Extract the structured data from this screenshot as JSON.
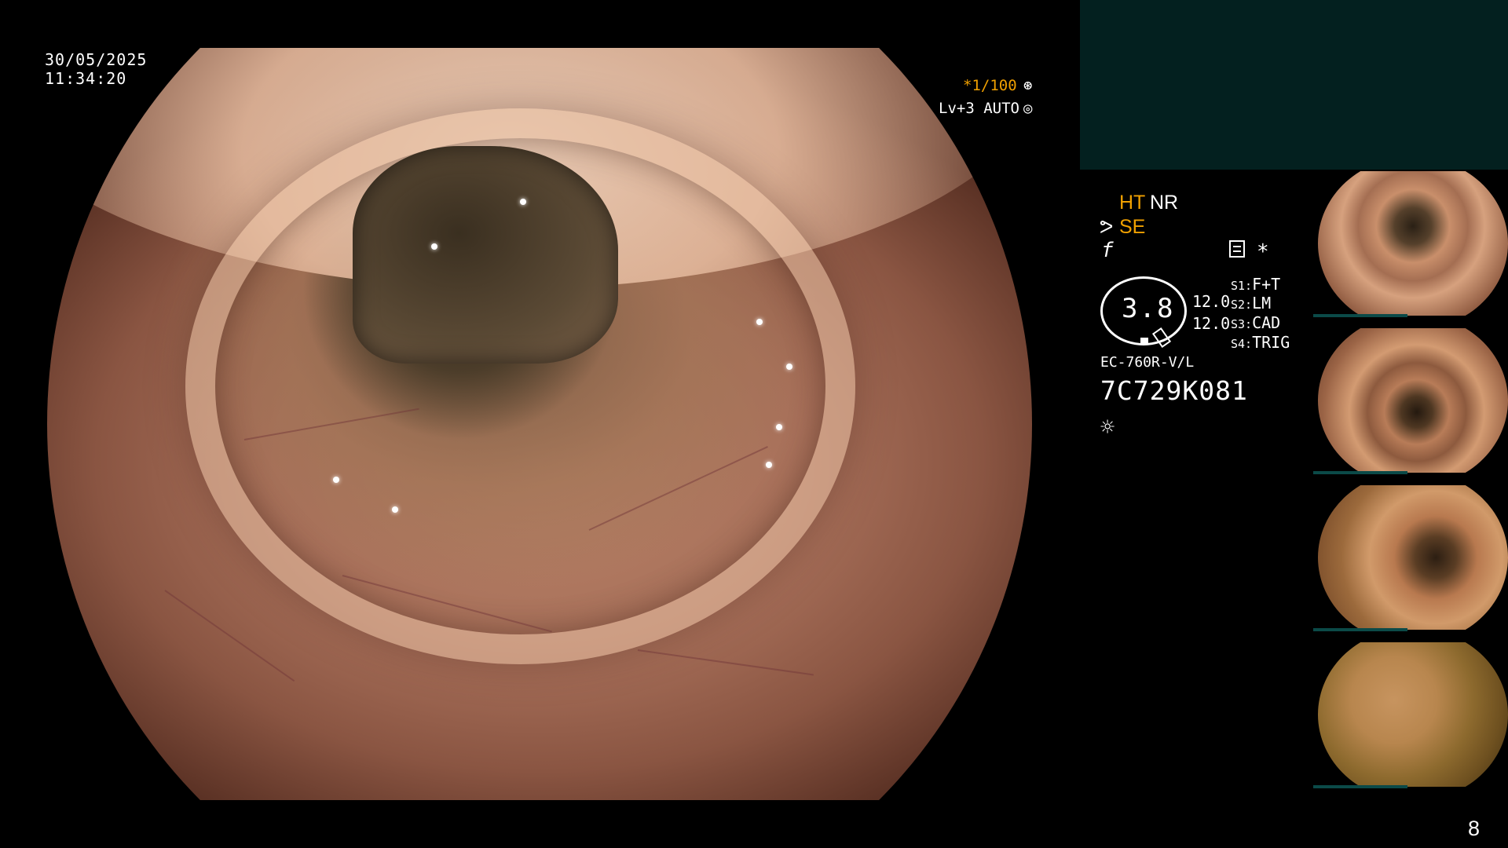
{
  "overlay": {
    "date": "30/05/2025",
    "time": "11:34:20",
    "shutter": "*1/100",
    "shutter_icon": "⊛",
    "level": "Lv+3 AUTO",
    "level_icon": "◎"
  },
  "settings": {
    "ht": "HT",
    "nr": "NR",
    "se_icon": "ᕗ",
    "se": "SE",
    "f_icon": "f",
    "asterisk": "*",
    "gauge_value": "3.8",
    "value_1": "12.0",
    "value_2": "12.0",
    "switches": [
      {
        "key": "S1:",
        "value": "F+T"
      },
      {
        "key": "S2:",
        "value": "LM"
      },
      {
        "key": "S3:",
        "value": "CAD"
      },
      {
        "key": "S4:",
        "value": "TRIG"
      }
    ],
    "model": "EC-760R-V/L",
    "serial": "7C729K081",
    "light_icon": "☼"
  },
  "page_number": "8",
  "icons": {
    "shutter": "shutter-icon",
    "level": "auto-level-icon",
    "memo": "memo-icon",
    "light": "light-icon"
  },
  "colors": {
    "accent": "#f0a000",
    "panel": "#03201f",
    "background": "#000000"
  }
}
